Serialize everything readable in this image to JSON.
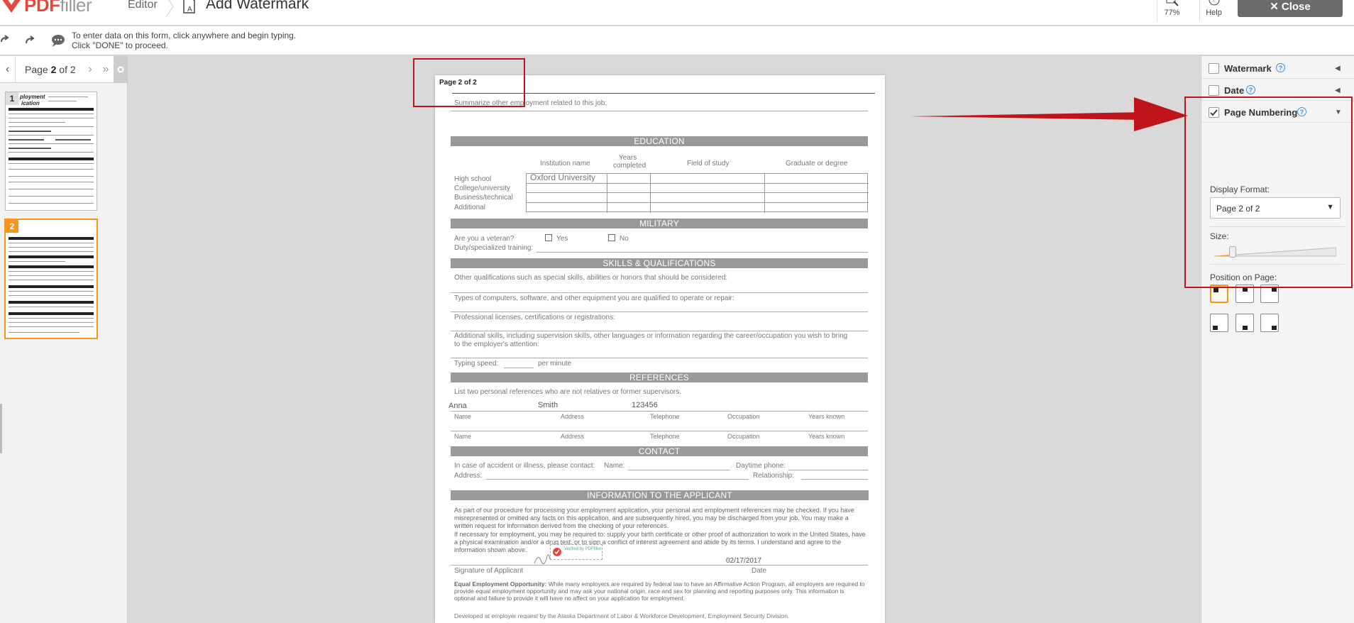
{
  "app": {
    "logo_main": "PDF",
    "logo_accent": "filler",
    "breadcrumb_editor": "Editor",
    "breadcrumb_title": "Add Watermark",
    "zoom_label": "77%",
    "help_label": "Help",
    "close_label": "Close"
  },
  "hint": {
    "line1": "To enter data on this form, click anywhere and begin typing.",
    "line2": "Click \"DONE\" to proceed."
  },
  "pager": {
    "prefix": "Page ",
    "current": "2",
    "suffix": " of 2"
  },
  "thumbnails": [
    {
      "num": "1",
      "title_line1": "ployment",
      "title_line2": "ication"
    },
    {
      "num": "2"
    }
  ],
  "document": {
    "page_number_text": "Page 2 of 2",
    "summarize": "Summarize other employment related to this job:",
    "education_header": "EDUCATION",
    "edu_cols": [
      "Institution name",
      "Years",
      "completed",
      "Field of study",
      "Graduate or degree"
    ],
    "edu_rows": [
      "High school",
      "College/university",
      "Business/technical",
      "Additional"
    ],
    "edu_filled": "Oxford University",
    "military_header": "MILITARY",
    "veteran_q": "Are you a veteran?",
    "yes": "Yes",
    "no": "No",
    "duty": "Duty/specialized training:",
    "skills_header": "SKILLS & QUALIFICATIONS",
    "skills_lines": [
      "Other qualifications such as special skills, abilities or honors that should be considered:",
      "Types of computers, software, and other equipment you are qualified to operate or repair:",
      "Professional licenses, certifications or registrations:",
      "Additional skills, including supervision skills, other languages or information regarding the career/occupation you wish to bring",
      "to the employer's attention:"
    ],
    "typing_speed": "Typing speed:",
    "per_minute": "per  minute",
    "references_header": "REFERENCES",
    "references_intro": "List two personal references who are not relatives or former supervisors.",
    "ref_filled": [
      "Anna",
      "Smith",
      "123456"
    ],
    "ref_cols": [
      "Name",
      "Address",
      "Telephone",
      "Occupation",
      "Years known"
    ],
    "contact_header": "CONTACT",
    "contact_line": "In case of accident or illness, please contact:",
    "contact_name": "Name:",
    "contact_daytime": "Daytime phone:",
    "contact_address": "Address:",
    "contact_relationship": "Relationship:",
    "info_header": "INFORMATION TO THE APPLICANT",
    "info_para": "As part of our procedure for processing your employment application, your personal and employment references may be checked. If you have misrepresented or omitted any facts on this application, and are subsequently hired, you may be discharged from your job. You may make a written request for information derived from the checking of your references.",
    "info_para2": "If necessary for employment, you may be required to: supply your birth certificate or other proof of authorization to work in the United States, have a physical examination and/or a drug test, or to sign a conflict of interest agreement and abide by its terms. I understand and agree to the information shown above.",
    "verified": "Verified by PDFfiller",
    "date_value": "02/17/2017",
    "sig_label": "Signature of Applicant",
    "date_label": "Date",
    "eeo_bold": "Equal Employment Opportunity:",
    "eeo_text": " While many employers are required by federal law to have an Affirmative Action Program, all employers are required to provide equal employment opportunity and may ask your national origin, race and sex for planning and reporting purposes only. This information is optional and failure to provide it will have no affect on your application for employment.",
    "footer": "Developed at employer request by the Alaska Department of Labor & Workforce Development, Employment Security Division."
  },
  "panel": {
    "watermark": "Watermark",
    "date": "Date",
    "page_numbering": "Page Numbering",
    "display_format_label": "Display Format:",
    "display_format_value": "Page 2 of 2",
    "size_label": "Size:",
    "position_label": "Position on Page:",
    "size_value": 0.15,
    "selected_position": "top-left"
  },
  "colors": {
    "accent_orange": "#f7941d",
    "annotation_red": "#c0141b",
    "logo_red": "#e2493b",
    "close_gray": "#6b6b6b"
  }
}
